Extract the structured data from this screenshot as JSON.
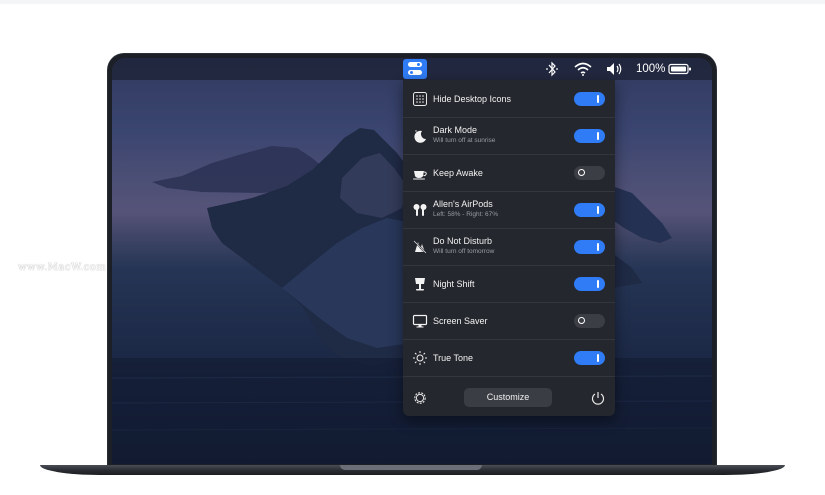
{
  "menubar": {
    "battery_text": "100%",
    "status_icons": [
      "app-toggle-icon",
      "bluetooth-icon",
      "wifi-icon",
      "volume-icon",
      "battery-icon"
    ]
  },
  "panel": {
    "items": [
      {
        "label": "Hide Desktop Icons",
        "subtitle": "",
        "icon": "desktop-grid-icon",
        "enabled": true
      },
      {
        "label": "Dark Mode",
        "subtitle": "Will turn off at sunrise",
        "icon": "moon-icon",
        "enabled": true
      },
      {
        "label": "Keep Awake",
        "subtitle": "",
        "icon": "coffee-cup-icon",
        "enabled": false
      },
      {
        "label": "Allen's AirPods",
        "subtitle": "Left: 58% - Right: 67%",
        "icon": "airpods-icon",
        "enabled": true
      },
      {
        "label": "Do Not Disturb",
        "subtitle": "Will turn off tomorrow",
        "icon": "do-not-disturb-icon",
        "enabled": true
      },
      {
        "label": "Night Shift",
        "subtitle": "",
        "icon": "lamp-icon",
        "enabled": true
      },
      {
        "label": "Screen Saver",
        "subtitle": "",
        "icon": "monitor-icon",
        "enabled": false
      },
      {
        "label": "True Tone",
        "subtitle": "",
        "icon": "sun-icon",
        "enabled": true
      }
    ],
    "footer": {
      "customize_label": "Customize",
      "left_icon": "settings-gear-icon",
      "right_icon": "power-icon"
    }
  },
  "watermark": "www.MacW.com",
  "colors": {
    "accent": "#2f7cf6",
    "panel_bg": "#24272d",
    "toggle_off": "#3b3e45"
  }
}
